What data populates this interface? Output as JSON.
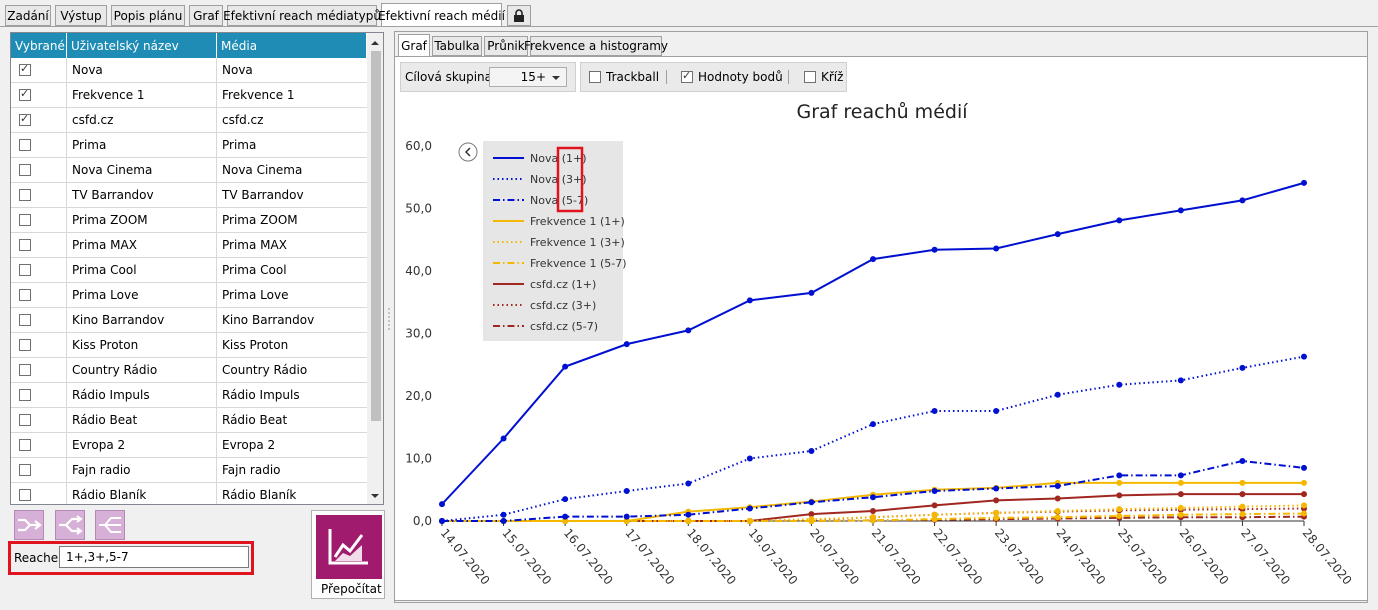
{
  "top_tabs": [
    {
      "label": "Zadání"
    },
    {
      "label": "Výstup"
    },
    {
      "label": "Popis plánu"
    },
    {
      "label": "Graf"
    },
    {
      "label": "Efektivní reach médiatypů"
    },
    {
      "label": "Efektivní reach médií"
    }
  ],
  "grid": {
    "headers": [
      "Vybrané",
      "Uživatelský název",
      "Média"
    ],
    "rows": [
      {
        "name": "Nova",
        "media": "Nova",
        "checked": true
      },
      {
        "name": "Frekvence 1",
        "media": "Frekvence 1",
        "checked": true
      },
      {
        "name": "csfd.cz",
        "media": "csfd.cz",
        "checked": true
      },
      {
        "name": "Prima",
        "media": "Prima",
        "checked": false
      },
      {
        "name": "Nova Cinema",
        "media": "Nova Cinema",
        "checked": false
      },
      {
        "name": "TV Barrandov",
        "media": "TV Barrandov",
        "checked": false
      },
      {
        "name": "Prima ZOOM",
        "media": "Prima ZOOM",
        "checked": false
      },
      {
        "name": "Prima MAX",
        "media": "Prima MAX",
        "checked": false
      },
      {
        "name": "Prima Cool",
        "media": "Prima Cool",
        "checked": false
      },
      {
        "name": "Prima Love",
        "media": "Prima Love",
        "checked": false
      },
      {
        "name": "Kino Barrandov",
        "media": "Kino Barrandov",
        "checked": false
      },
      {
        "name": "Kiss Proton",
        "media": "Kiss Proton",
        "checked": false
      },
      {
        "name": "Country Rádio",
        "media": "Country Rádio",
        "checked": false
      },
      {
        "name": "Rádio Impuls",
        "media": "Rádio Impuls",
        "checked": false
      },
      {
        "name": "Rádio Beat",
        "media": "Rádio Beat",
        "checked": false
      },
      {
        "name": "Evropa 2",
        "media": "Evropa 2",
        "checked": false
      },
      {
        "name": "Fajn radio",
        "media": "Fajn radio",
        "checked": false
      },
      {
        "name": "Rádio Blaník",
        "media": "Rádio Blaník",
        "checked": false
      }
    ]
  },
  "reache": {
    "label": "Reache:",
    "value": "1+,3+,5-7"
  },
  "prepocitat_label": "Přepočítat",
  "sub_tabs": [
    {
      "label": "Graf"
    },
    {
      "label": "Tabulka"
    },
    {
      "label": "Průnik"
    },
    {
      "label": "Frekvence a histogramy"
    }
  ],
  "toolbar": {
    "target_label": "Cílová skupina:",
    "target_value": "15+",
    "trackball": "Trackball",
    "point_values": "Hodnoty bodů",
    "cross": "Kříž",
    "trackball_checked": false,
    "point_values_checked": true,
    "cross_checked": false
  },
  "colors": {
    "blue": "#0010d0",
    "gold": "#f5b800",
    "darkred": "#a02820",
    "accent": "#1e8cb4",
    "highlight": "#e0141e",
    "prepoc": "#a01a6e"
  },
  "chart_data": {
    "type": "line",
    "title": "Graf reachů médií",
    "categories": [
      "14.07.2020",
      "15.07.2020",
      "16.07.2020",
      "17.07.2020",
      "18.07.2020",
      "19.07.2020",
      "20.07.2020",
      "21.07.2020",
      "22.07.2020",
      "23.07.2020",
      "24.07.2020",
      "25.07.2020",
      "26.07.2020",
      "27.07.2020",
      "28.07.2020"
    ],
    "y_ticks": [
      "0,0",
      "10,0",
      "20,0",
      "30,0",
      "40,0",
      "50,0",
      "60,0"
    ],
    "ylim": [
      0,
      60
    ],
    "legend_position": "top-left",
    "series": [
      {
        "name": "Nova (1+)",
        "color": "#0010d0",
        "dash": "solid",
        "values": [
          2.7,
          13.2,
          24.7,
          28.3,
          30.5,
          35.3,
          36.5,
          41.9,
          43.4,
          43.6,
          45.9,
          48.1,
          49.7,
          51.3,
          54.1
        ]
      },
      {
        "name": "Nova (3+)",
        "color": "#0010d0",
        "dash": "dot",
        "values": [
          0,
          1.0,
          3.5,
          4.8,
          6.0,
          10.0,
          11.2,
          15.5,
          17.6,
          17.6,
          20.2,
          21.8,
          22.5,
          24.5,
          26.3
        ]
      },
      {
        "name": "Nova (5-7)",
        "color": "#0010d0",
        "dash": "dashdot",
        "values": [
          0,
          0,
          0.7,
          0.7,
          1.0,
          2.0,
          3.0,
          3.8,
          4.8,
          5.2,
          5.6,
          7.3,
          7.3,
          9.6,
          8.5
        ]
      },
      {
        "name": "Frekvence 1 (1+)",
        "color": "#f5b800",
        "dash": "solid",
        "values": [
          0,
          0,
          0,
          0,
          1.5,
          2.2,
          3.1,
          4.2,
          5.0,
          5.3,
          6.1,
          6.1,
          6.1,
          6.1,
          6.1
        ]
      },
      {
        "name": "Frekvence 1 (3+)",
        "color": "#f5b800",
        "dash": "dot",
        "values": [
          0,
          0,
          0,
          0,
          0,
          0,
          0.3,
          0.6,
          1.0,
          1.3,
          1.6,
          1.9,
          2.1,
          2.3,
          2.5
        ]
      },
      {
        "name": "Frekvence 1 (5-7)",
        "color": "#f5b800",
        "dash": "dashdot",
        "values": [
          0,
          0,
          0,
          0,
          0,
          0,
          0,
          0.1,
          0.3,
          0.5,
          0.6,
          0.8,
          1.0,
          1.1,
          1.2
        ]
      },
      {
        "name": "csfd.cz (1+)",
        "color": "#a02820",
        "dash": "solid",
        "values": [
          0,
          0,
          0,
          0,
          0,
          0,
          1.1,
          1.6,
          2.5,
          3.3,
          3.6,
          4.1,
          4.3,
          4.3,
          4.3
        ]
      },
      {
        "name": "csfd.cz (3+)",
        "color": "#a02820",
        "dash": "dot",
        "values": [
          0,
          0,
          0,
          0,
          0,
          0,
          0.2,
          0.6,
          1.0,
          1.3,
          1.5,
          1.7,
          1.8,
          1.9,
          2.0
        ]
      },
      {
        "name": "csfd.cz (5-7)",
        "color": "#a02820",
        "dash": "dashdot",
        "values": [
          0,
          0,
          0,
          0,
          0,
          0,
          0,
          0.1,
          0.2,
          0.3,
          0.4,
          0.5,
          0.6,
          0.6,
          0.7
        ]
      }
    ]
  }
}
